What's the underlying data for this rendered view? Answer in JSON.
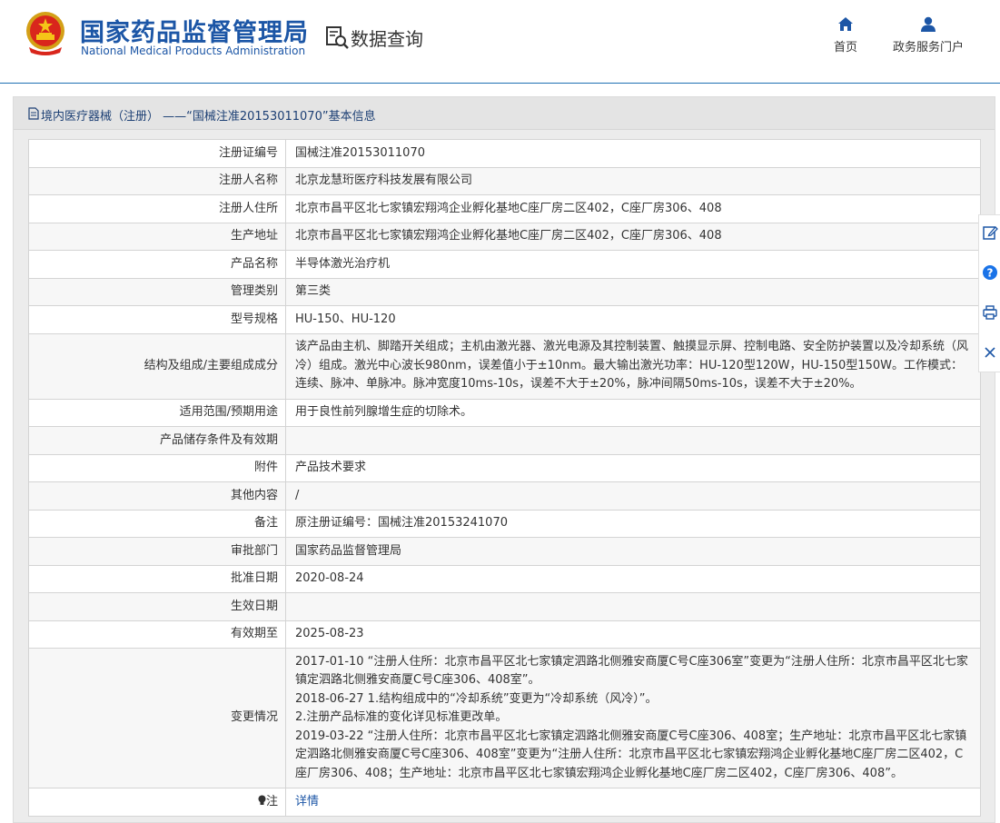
{
  "header": {
    "org_cn": "国家药品监督管理局",
    "org_en": "National Medical Products Administration",
    "query_label": "数据查询",
    "nav": [
      {
        "label": "首页",
        "icon": "home-icon"
      },
      {
        "label": "政务服务门户",
        "icon": "user-icon"
      }
    ]
  },
  "panel": {
    "title": "境内医疗器械（注册） ——“国械注准20153011070”基本信息"
  },
  "rows": [
    {
      "label": "注册证编号",
      "value": "国械注准20153011070"
    },
    {
      "label": "注册人名称",
      "value": "北京龙慧珩医疗科技发展有限公司"
    },
    {
      "label": "注册人住所",
      "value": "北京市昌平区北七家镇宏翔鸿企业孵化基地C座厂房二区402，C座厂房306、408"
    },
    {
      "label": "生产地址",
      "value": "北京市昌平区北七家镇宏翔鸿企业孵化基地C座厂房二区402，C座厂房306、408"
    },
    {
      "label": "产品名称",
      "value": "半导体激光治疗机"
    },
    {
      "label": "管理类别",
      "value": "第三类"
    },
    {
      "label": "型号规格",
      "value": "HU-150、HU-120"
    },
    {
      "label": "结构及组成/主要组成成分",
      "value": "该产品由主机、脚踏开关组成；主机由激光器、激光电源及其控制装置、触摸显示屏、控制电路、安全防护装置以及冷却系统（风冷）组成。激光中心波长980nm，误差值小于±10nm。最大输出激光功率：HU-120型120W，HU-150型150W。工作模式：连续、脉冲、单脉冲。脉冲宽度10ms-10s，误差不大于±20%，脉冲间隔50ms-10s，误差不大于±20%。"
    },
    {
      "label": "适用范围/预期用途",
      "value": "用于良性前列腺增生症的切除术。"
    },
    {
      "label": "产品储存条件及有效期",
      "value": ""
    },
    {
      "label": "附件",
      "value": "产品技术要求"
    },
    {
      "label": "其他内容",
      "value": "/"
    },
    {
      "label": "备注",
      "value": "原注册证编号：国械注准20153241070"
    },
    {
      "label": "审批部门",
      "value": "国家药品监督管理局"
    },
    {
      "label": "批准日期",
      "value": "2020-08-24"
    },
    {
      "label": "生效日期",
      "value": ""
    },
    {
      "label": "有效期至",
      "value": "2025-08-23"
    }
  ],
  "changes": {
    "label": "变更情况",
    "lines": [
      "2017-01-10 “注册人住所：北京市昌平区北七家镇定泗路北侧雅安商厦C号C座306室”变更为“注册人住所：北京市昌平区北七家镇定泗路北侧雅安商厦C号C座306、408室”。",
      "2018-06-27 1.结构组成中的“冷却系统”变更为“冷却系统（风冷）”。",
      "2.注册产品标准的变化详见标准更改单。",
      "2019-03-22 “注册人住所：北京市昌平区北七家镇定泗路北侧雅安商厦C号C座306、408室；生产地址：北京市昌平区北七家镇定泗路北侧雅安商厦C号C座306、408室”变更为“注册人住所：北京市昌平区北七家镇宏翔鸿企业孵化基地C座厂房二区402，C座厂房306、408；生产地址：北京市昌平区北七家镇宏翔鸿企业孵化基地C座厂房二区402，C座厂房306、408”。"
    ]
  },
  "note": {
    "label": "注",
    "link": "详情"
  },
  "side_tools": [
    "edit-icon",
    "help-icon",
    "print-icon",
    "close-icon"
  ],
  "colors": {
    "brand": "#1c56a6",
    "header_line": "#1e6fb3",
    "help_blue": "#1a73e8"
  }
}
